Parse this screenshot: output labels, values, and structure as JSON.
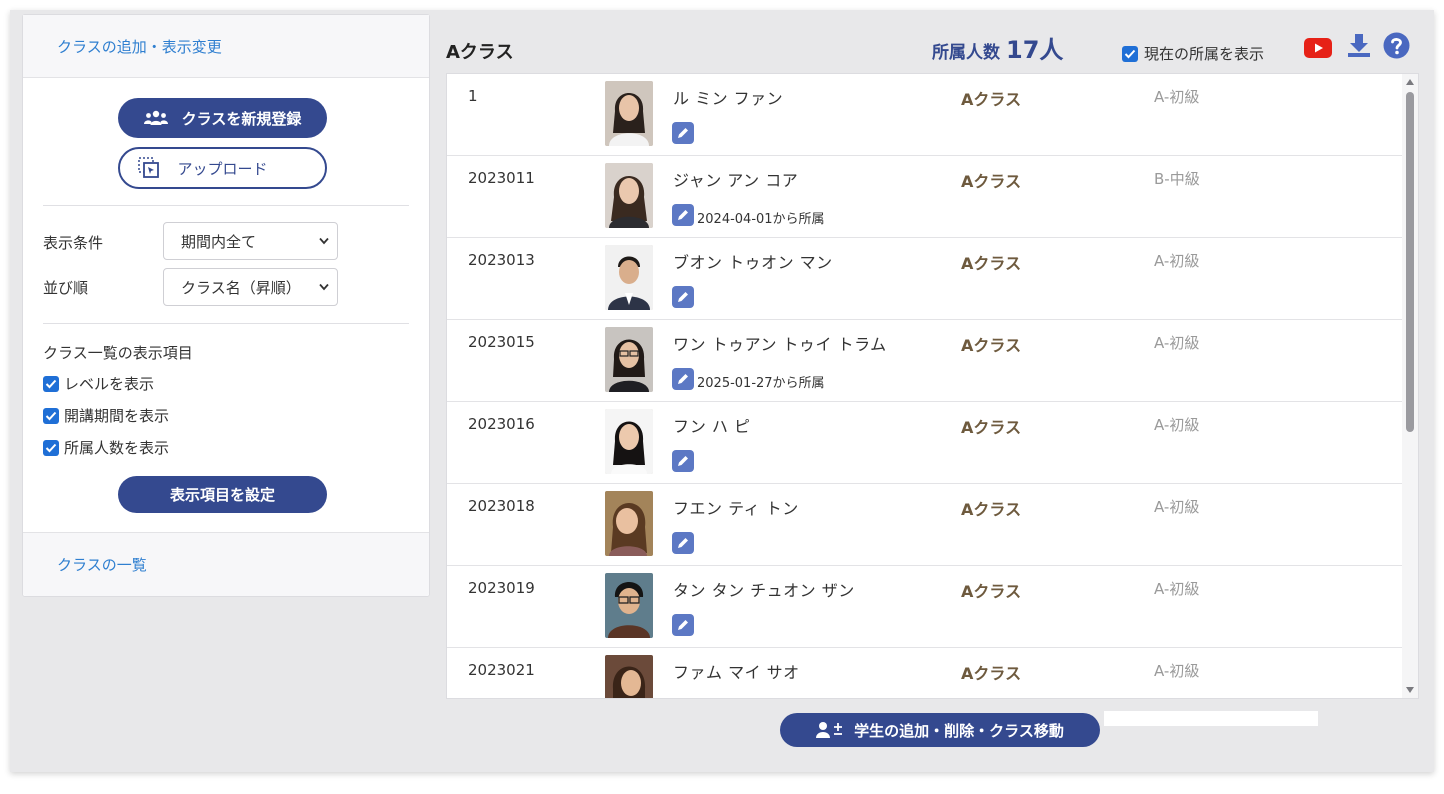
{
  "sidebar": {
    "header_link": "クラスの追加・表示変更",
    "register_button": "クラスを新規登録",
    "upload_button": "アップロード",
    "display_condition_label": "表示条件",
    "display_condition_value": "期間内全て",
    "sort_label": "並び順",
    "sort_value": "クラス名（昇順）",
    "display_items_title": "クラス一覧の表示項目",
    "checkboxes": [
      {
        "label": "レベルを表示",
        "checked": true
      },
      {
        "label": "開講期間を表示",
        "checked": true
      },
      {
        "label": "所属人数を表示",
        "checked": true
      }
    ],
    "set_items_button": "表示項目を設定",
    "footer_link": "クラスの一覧"
  },
  "main": {
    "class_title": "Aクラス",
    "member_count_label": "所属人数",
    "member_count_value": "17人",
    "show_current_label": "現在の所属を表示",
    "show_current_checked": true,
    "icons": [
      "youtube-icon",
      "download-icon",
      "help-icon"
    ],
    "students": [
      {
        "id": "1",
        "name": "ル ミン ファン",
        "since": "",
        "class": "Aクラス",
        "level": "A-初級"
      },
      {
        "id": "2023011",
        "name": "ジャン アン コア",
        "since": "2024-04-01から所属",
        "class": "Aクラス",
        "level": "B-中級"
      },
      {
        "id": "2023013",
        "name": "ブオン トゥオン マン",
        "since": "",
        "class": "Aクラス",
        "level": "A-初級"
      },
      {
        "id": "2023015",
        "name": "ワン トゥアン トゥイ トラム",
        "since": "2025-01-27から所属",
        "class": "Aクラス",
        "level": "A-初級"
      },
      {
        "id": "2023016",
        "name": "フン ハ ピ",
        "since": "",
        "class": "Aクラス",
        "level": "A-初級"
      },
      {
        "id": "2023018",
        "name": "フエン ティ トン",
        "since": "",
        "class": "Aクラス",
        "level": "A-初級"
      },
      {
        "id": "2023019",
        "name": "タン タン チュオン ザン",
        "since": "",
        "class": "Aクラス",
        "level": "A-初級"
      },
      {
        "id": "2023021",
        "name": "ファム マイ サオ",
        "since": "",
        "class": "Aクラス",
        "level": "A-初級"
      }
    ],
    "bottom_button": "学生の追加・削除・クラス移動"
  },
  "colors": {
    "accent": "#34498f",
    "link": "#2f7fd0",
    "class_text": "#6e5a3e",
    "level_text": "#9a9a9a",
    "youtube": "#e62117",
    "help": "#4a68c0"
  }
}
